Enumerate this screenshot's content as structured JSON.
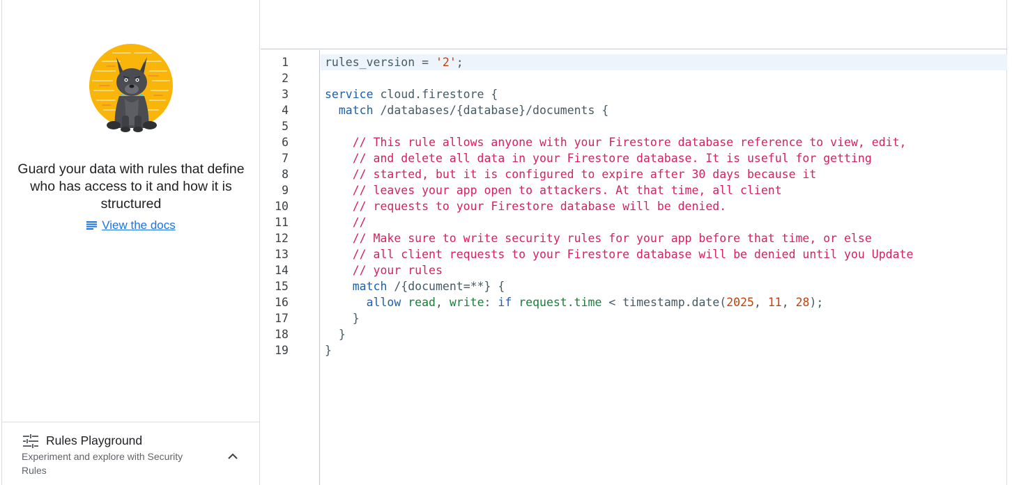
{
  "left_panel": {
    "guard_text": "Guard your data with rules that define who has access to it and how it is structured",
    "docs_link": "View the docs",
    "playground": {
      "title": "Rules Playground",
      "description": "Experiment and explore with Security Rules"
    }
  },
  "editor": {
    "line_numbers": [
      "1",
      "2",
      "3",
      "4",
      "5",
      "6",
      "7",
      "8",
      "9",
      "10",
      "11",
      "12",
      "13",
      "14",
      "15",
      "16",
      "17",
      "18",
      "19"
    ],
    "lines": [
      [
        {
          "t": "pl",
          "v": "rules_version = "
        },
        {
          "t": "str",
          "v": "'2'"
        },
        {
          "t": "pl",
          "v": ";"
        }
      ],
      [],
      [
        {
          "t": "kw",
          "v": "service"
        },
        {
          "t": "pl",
          "v": " cloud.firestore {"
        }
      ],
      [
        {
          "t": "pl",
          "v": "  "
        },
        {
          "t": "kw",
          "v": "match"
        },
        {
          "t": "pl",
          "v": " /databases/{database}/documents {"
        }
      ],
      [],
      [
        {
          "t": "cm",
          "v": "    // This rule allows anyone with your Firestore database reference to view, edit,"
        }
      ],
      [
        {
          "t": "cm",
          "v": "    // and delete all data in your Firestore database. It is useful for getting"
        }
      ],
      [
        {
          "t": "cm",
          "v": "    // started, but it is configured to expire after 30 days because it"
        }
      ],
      [
        {
          "t": "cm",
          "v": "    // leaves your app open to attackers. At that time, all client"
        }
      ],
      [
        {
          "t": "cm",
          "v": "    // requests to your Firestore database will be denied."
        }
      ],
      [
        {
          "t": "cm",
          "v": "    //"
        }
      ],
      [
        {
          "t": "cm",
          "v": "    // Make sure to write security rules for your app before that time, or else"
        }
      ],
      [
        {
          "t": "cm",
          "v": "    // all client requests to your Firestore database will be denied until you Update"
        }
      ],
      [
        {
          "t": "cm",
          "v": "    // your rules"
        }
      ],
      [
        {
          "t": "pl",
          "v": "    "
        },
        {
          "t": "kw",
          "v": "match"
        },
        {
          "t": "pl",
          "v": " /{document=**} {"
        }
      ],
      [
        {
          "t": "pl",
          "v": "      "
        },
        {
          "t": "kw",
          "v": "allow"
        },
        {
          "t": "pl",
          "v": " "
        },
        {
          "t": "id",
          "v": "read"
        },
        {
          "t": "pl",
          "v": ", "
        },
        {
          "t": "id",
          "v": "write"
        },
        {
          "t": "pl",
          "v": ": "
        },
        {
          "t": "kw",
          "v": "if"
        },
        {
          "t": "pl",
          "v": " "
        },
        {
          "t": "id",
          "v": "request.time"
        },
        {
          "t": "pl",
          "v": " < timestamp.date("
        },
        {
          "t": "num",
          "v": "2025"
        },
        {
          "t": "pl",
          "v": ", "
        },
        {
          "t": "num",
          "v": "11"
        },
        {
          "t": "pl",
          "v": ", "
        },
        {
          "t": "num",
          "v": "28"
        },
        {
          "t": "pl",
          "v": ");"
        }
      ],
      [
        {
          "t": "pl",
          "v": "    }"
        }
      ],
      [
        {
          "t": "pl",
          "v": "  }"
        }
      ],
      [
        {
          "t": "pl",
          "v": "}"
        }
      ]
    ],
    "active_line": 1
  },
  "colors": {
    "link": "#1a73e8",
    "keyword": "#1a5fb4",
    "comment": "#d6215c",
    "string": "#c2410c",
    "identifier": "#188038",
    "active_line_bg": "#eef4fb",
    "mascot_circle": "#f9b50a"
  },
  "icons": {
    "docs": "notes-icon",
    "playground": "tune-icon",
    "collapse": "chevron-up-icon",
    "illustration": "dog-mascot-illustration"
  }
}
